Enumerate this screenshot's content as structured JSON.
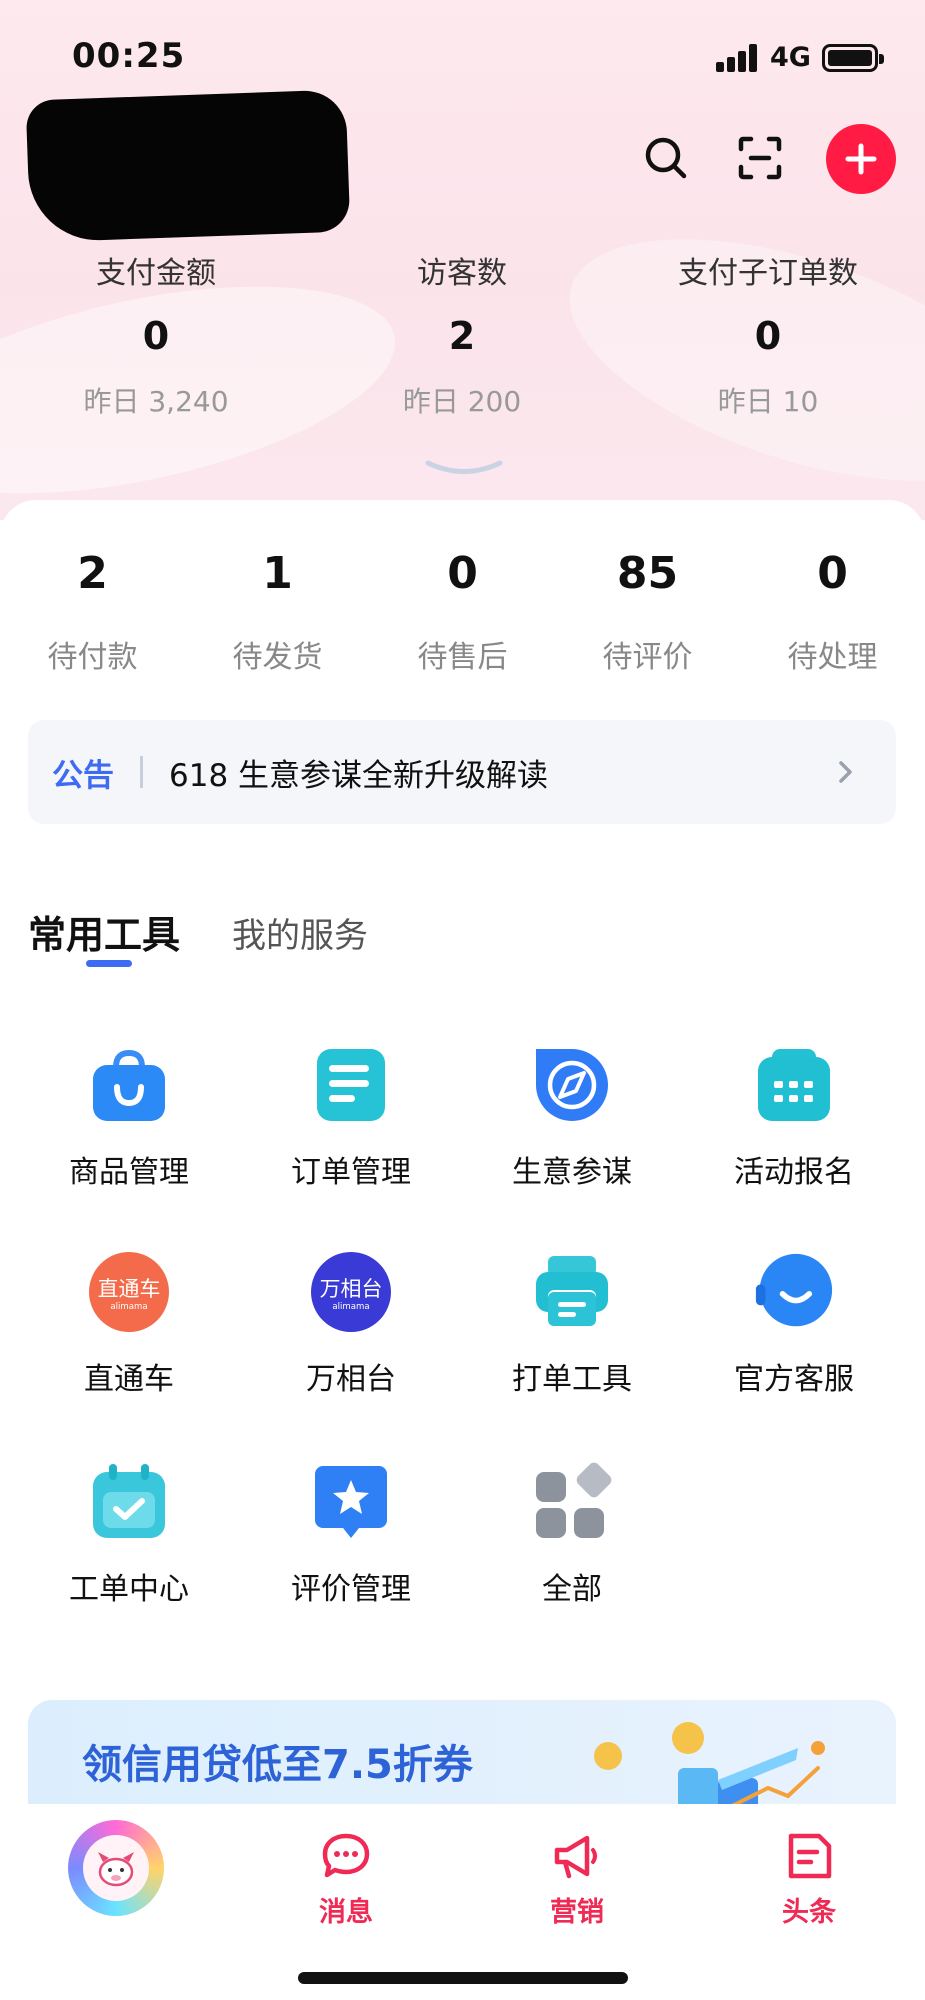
{
  "status_bar": {
    "time": "00:25",
    "network": "4G"
  },
  "header": {
    "metrics": [
      {
        "label": "支付金额",
        "value": "0",
        "prev": "昨日 3,240"
      },
      {
        "label": "访客数",
        "value": "2",
        "prev": "昨日 200"
      },
      {
        "label": "支付子订单数",
        "value": "0",
        "prev": "昨日 10"
      }
    ]
  },
  "order_stats": [
    {
      "value": "2",
      "label": "待付款"
    },
    {
      "value": "1",
      "label": "待发货"
    },
    {
      "value": "0",
      "label": "待售后"
    },
    {
      "value": "85",
      "label": "待评价"
    },
    {
      "value": "0",
      "label": "待处理"
    }
  ],
  "notice": {
    "tag": "公告",
    "text": "618 生意参谋全新升级解读"
  },
  "tabs": {
    "active": "常用工具",
    "inactive": "我的服务"
  },
  "tools": [
    {
      "label": "商品管理",
      "icon": "shopping-bag-icon"
    },
    {
      "label": "订单管理",
      "icon": "order-list-icon"
    },
    {
      "label": "生意参谋",
      "icon": "compass-icon"
    },
    {
      "label": "活动报名",
      "icon": "calendar-grid-icon"
    },
    {
      "label": "直通车",
      "icon": "ztc-logo-icon",
      "logo_text": "直通车",
      "logo_sub": "alimama"
    },
    {
      "label": "万相台",
      "icon": "wxt-logo-icon",
      "logo_text": "万相台",
      "logo_sub": "alimama"
    },
    {
      "label": "打单工具",
      "icon": "printer-icon"
    },
    {
      "label": "官方客服",
      "icon": "headset-icon"
    },
    {
      "label": "工单中心",
      "icon": "calendar-check-icon"
    },
    {
      "label": "评价管理",
      "icon": "star-badge-icon"
    },
    {
      "label": "全部",
      "icon": "all-apps-icon"
    }
  ],
  "banner": {
    "text": "领信用贷低至7.5折券"
  },
  "bottom_nav": [
    {
      "label": "消息",
      "icon": "chat-bubble-icon"
    },
    {
      "label": "营销",
      "icon": "megaphone-icon"
    },
    {
      "label": "头条",
      "icon": "news-icon"
    }
  ],
  "colors": {
    "accent": "#ff1b44",
    "nav_red": "#ef2a55",
    "blue": "#3d6cf3"
  }
}
